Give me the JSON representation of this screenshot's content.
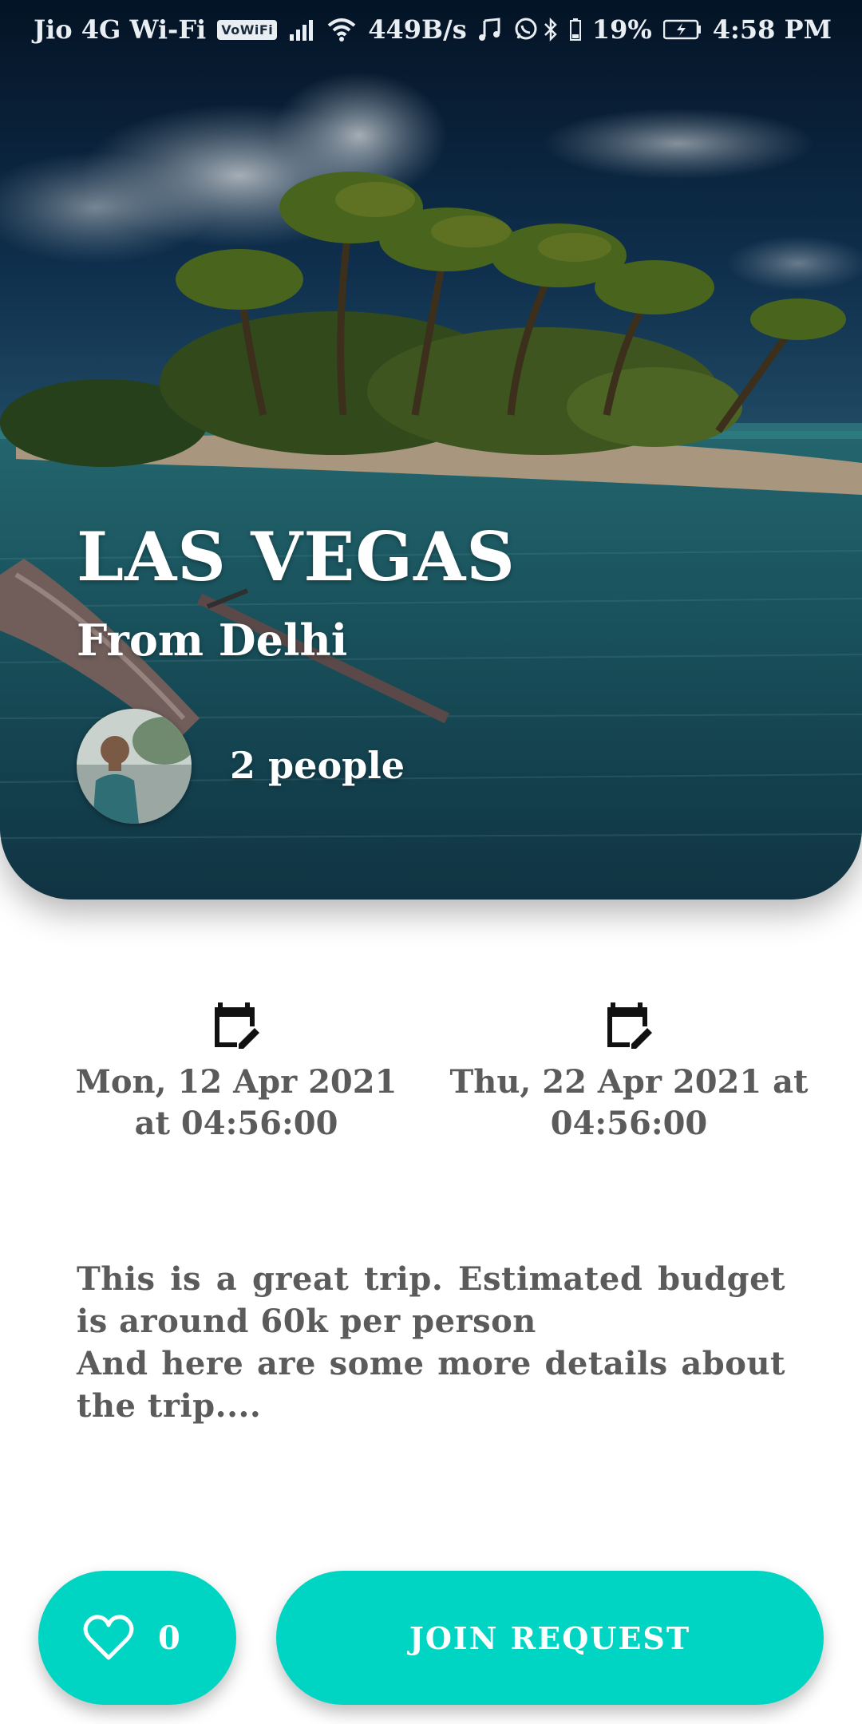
{
  "status_bar": {
    "carrier": "Jio 4G Wi-Fi",
    "vowifi": "VoWiFi",
    "net_speed": "449B/s",
    "battery": "19%",
    "time": "4:58 PM"
  },
  "trip": {
    "destination": "LAS VEGAS",
    "origin": "From Delhi",
    "people": "2 people",
    "start_date": "Mon, 12 Apr 2021 at 04:56:00",
    "end_date": "Thu, 22 Apr 2021 at 04:56:00",
    "description": "This is a great trip. Estimated budget is around 60k per person\nAnd here are some more details about the trip...."
  },
  "actions": {
    "like_count": "0",
    "join_label": "JOIN REQUEST"
  },
  "colors": {
    "accent": "#00d4c2",
    "text_gray": "#5b5b5b",
    "white": "#ffffff"
  },
  "icons": {
    "calendar": "calendar-edit-icon",
    "heart": "heart-outline-icon",
    "avatar": "avatar"
  }
}
